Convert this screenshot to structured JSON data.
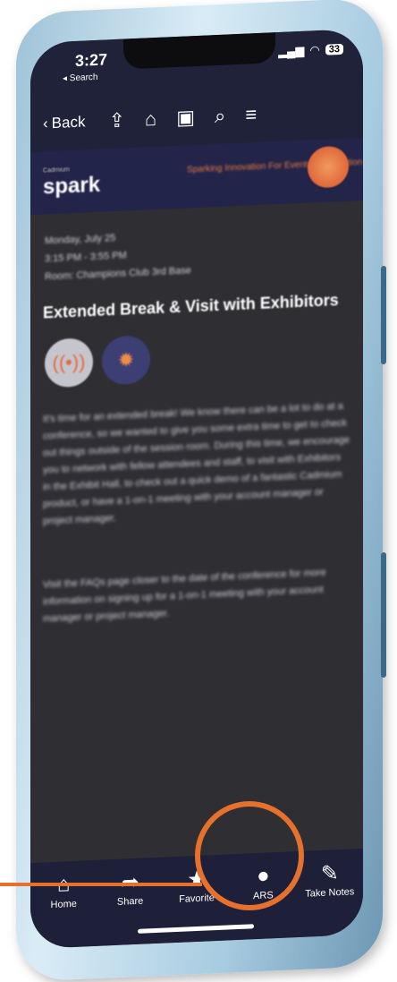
{
  "status": {
    "time": "3:27",
    "back_app": "◂ Search",
    "battery": "33"
  },
  "toolbar": {
    "back_label": "Back"
  },
  "banner": {
    "logo_small": "Cadmium",
    "logo": "spark",
    "tagline": "Sparking Innovation For Events & Education"
  },
  "session": {
    "date": "Monday, July 25",
    "time": "3:15 PM - 3:55 PM",
    "room": "Room: Champions Club 3rd Base",
    "title": "Extended Break & Visit with Exhibitors",
    "paragraph1": "It's time for an extended break! We know there can be a lot to do at a conference, so we wanted to give you some extra time to get to check out things outside of the session room. During this time, we encourage you to network with fellow attendees and staff, to visit with Exhibitors in the Exhibit Hall, to check out a quick demo of a fantastic Cadmium product, or have a 1-on-1 meeting with your account manager or project manager.",
    "paragraph2": "Visit the FAQs page closer to the date of the conference for more information on signing up for a 1-on-1 meeting with your account manager or project manager."
  },
  "tabs": [
    {
      "label": "Home",
      "icon": "home-icon"
    },
    {
      "label": "Share",
      "icon": "share-arrow-icon"
    },
    {
      "label": "Favorite",
      "icon": "star-icon"
    },
    {
      "label": "ARS",
      "icon": "chat-bubbles-icon"
    },
    {
      "label": "Take Notes",
      "icon": "pencil-icon"
    }
  ],
  "colors": {
    "header_bg": "#20223a",
    "content_bg": "#2e2e33",
    "accent_orange": "#e5712c"
  }
}
